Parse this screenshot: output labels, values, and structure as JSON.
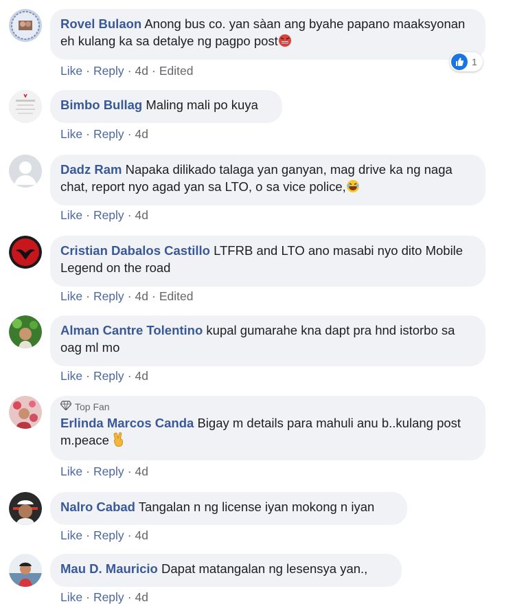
{
  "actions": {
    "like": "Like",
    "reply": "Reply",
    "edited": "Edited"
  },
  "comments": [
    {
      "name": "Rovel Bulaon",
      "text": "Anong bus co. yan sàan ang byahe papano maaksyonan eh kulang ka sa detalye ng pagpo post",
      "emoji": "angry-face",
      "time": "4d",
      "edited": true,
      "reactions": "1"
    },
    {
      "name": "Bimbo Bullag",
      "text": "Maling mali po kuya",
      "time": "4d"
    },
    {
      "name": "Dadz Ram",
      "text": "Napaka dilikado talaga yan ganyan, mag drive ka ng naga chat, report nyo agad yan sa LTO, o sa vice police,",
      "emoji": "laughing-face",
      "time": "4d"
    },
    {
      "name": "Cristian Dabalos Castillo",
      "text": "LTFRB and LTO ano masabi nyo dito Mobile Legend on the road",
      "time": "4d",
      "edited": true
    },
    {
      "name": "Alman Cantre Tolentino",
      "text": "kupal gumarahe kna dapt pra hnd istorbo sa oag ml mo",
      "time": "4d"
    },
    {
      "badge": "Top Fan",
      "name": "Erlinda Marcos Canda",
      "text": "Bigay m details para mahuli anu b..kulang post m.peace",
      "emoji": "victory-hand",
      "time": "4d"
    },
    {
      "name": "Nalro Cabad",
      "text": "Tangalan n ng license iyan mokong n iyan",
      "time": "4d"
    },
    {
      "name": "Mau D. Mauricio",
      "text": "Dapat matangalan ng lesensya yan.,",
      "time": "4d"
    }
  ]
}
